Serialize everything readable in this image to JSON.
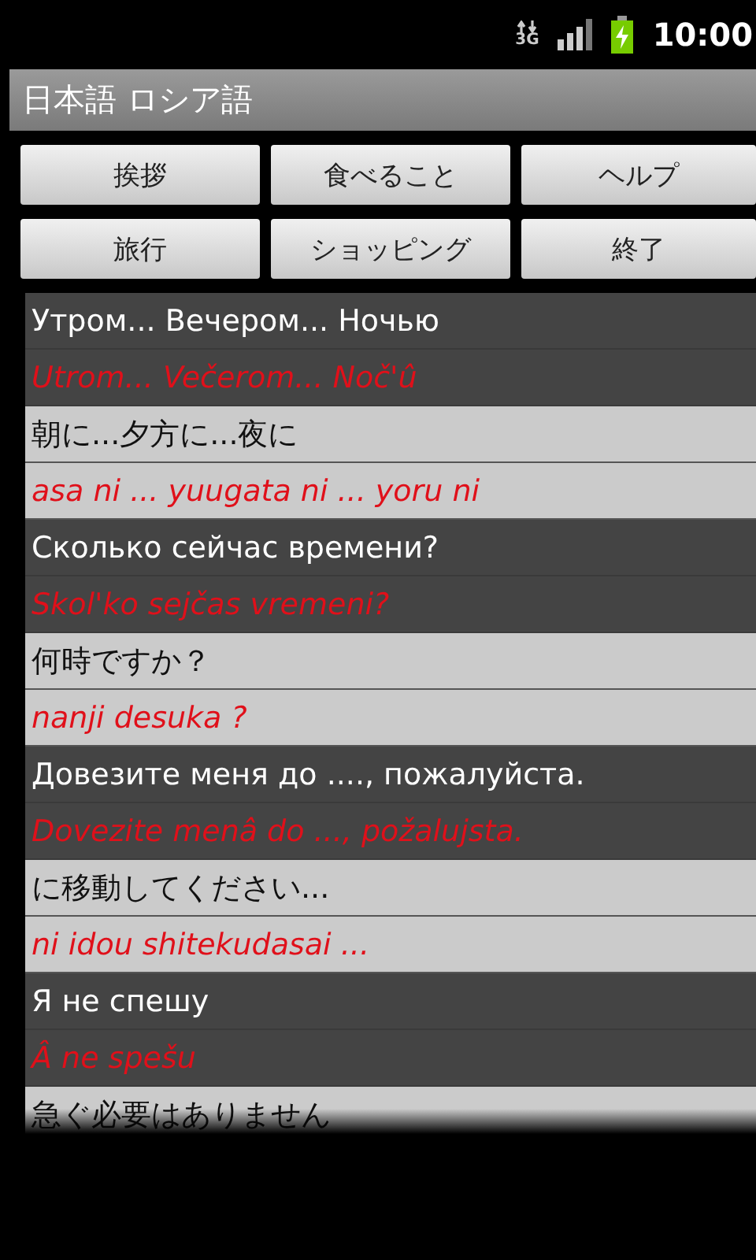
{
  "status_bar": {
    "network": "3G",
    "time": "10:00"
  },
  "window": {
    "title": "日本語 ロシア語"
  },
  "buttons": [
    {
      "label": "挨拶"
    },
    {
      "label": "食べること"
    },
    {
      "label": "ヘルプ"
    },
    {
      "label": "旅行"
    },
    {
      "label": "ショッピング"
    },
    {
      "label": "終了"
    }
  ],
  "phrases": [
    {
      "kind": "dark",
      "text": "Утром... Вечером... Ночью",
      "transliteration": "Utrom... Večerom... Noč'û"
    },
    {
      "kind": "light",
      "text": "朝に...夕方に...夜に",
      "transliteration": "asa ni ... yuugata ni ... yoru ni"
    },
    {
      "kind": "dark",
      "text": "Сколько сейчас времени?",
      "transliteration": "Skol'ko sejčas vremeni?"
    },
    {
      "kind": "light",
      "text": "何時ですか？",
      "transliteration": "nanji desuka ?"
    },
    {
      "kind": "dark",
      "text": "Довезите меня до ...., пожалуйста.",
      "transliteration": "Dovezite menâ do ..., požalujsta."
    },
    {
      "kind": "light",
      "text": "に移動してください...",
      "transliteration": "ni idou shitekudasai ..."
    },
    {
      "kind": "dark",
      "text": "Я не спешу",
      "transliteration": "Â ne spešu"
    },
    {
      "kind": "light",
      "text": "急ぐ必要はありません"
    }
  ]
}
